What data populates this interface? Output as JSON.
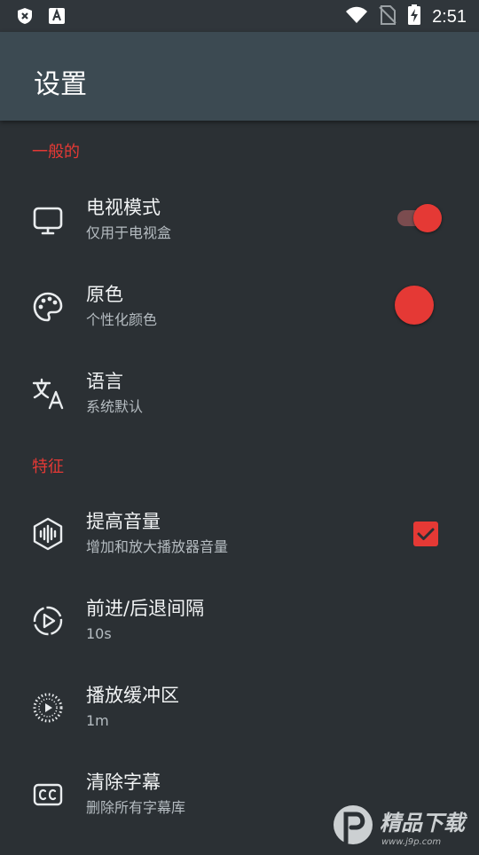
{
  "status_bar": {
    "time": "2:51",
    "icons": [
      "shield-x-icon",
      "font-a-icon",
      "wifi-icon",
      "no-sim-icon",
      "battery-charging-icon"
    ]
  },
  "app_bar": {
    "title": "设置"
  },
  "sections": {
    "general": {
      "header": "一般的"
    },
    "features": {
      "header": "特征"
    }
  },
  "items": {
    "tv_mode": {
      "title": "电视模式",
      "subtitle": "仅用于电视盒",
      "icon": "monitor-icon",
      "toggle_on": true
    },
    "primary_color": {
      "title": "原色",
      "subtitle": "个性化颜色",
      "icon": "palette-icon",
      "color": "#e53935"
    },
    "language": {
      "title": "语言",
      "subtitle": "系统默认",
      "icon": "translate-icon"
    },
    "boost_volume": {
      "title": "提高音量",
      "subtitle": "增加和放大播放器音量",
      "icon": "volume-wave-icon",
      "checked": true
    },
    "seek_interval": {
      "title": "前进/后退间隔",
      "subtitle": "10s",
      "icon": "play-circle-dashed-icon"
    },
    "buffer": {
      "title": "播放缓冲区",
      "subtitle": "1m",
      "icon": "buffer-icon"
    },
    "clear_subtitles": {
      "title": "清除字幕",
      "subtitle": "删除所有字幕库",
      "icon": "cc-icon"
    }
  },
  "watermark": {
    "text": "精品下载",
    "url": "www.j9p.com"
  },
  "colors": {
    "accent": "#e53935",
    "background": "#2b3034",
    "app_bar": "#3c4a52"
  }
}
